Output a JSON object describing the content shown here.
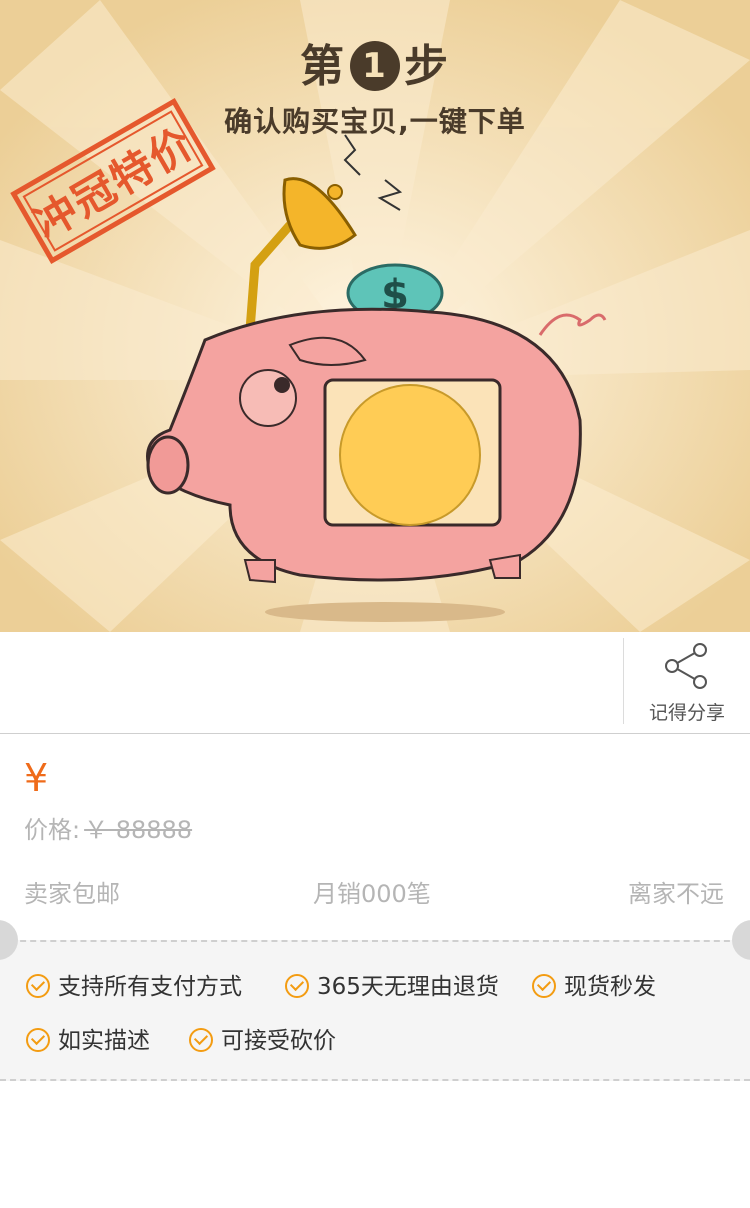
{
  "banner": {
    "step_prefix": "第",
    "step_number": "1",
    "step_suffix": "步",
    "subtitle": "确认购买宝贝,一键下单",
    "stamp_text": "冲冠特价",
    "coin_symbol": "$"
  },
  "share": {
    "label": "记得分享",
    "icon": "share-icon"
  },
  "price": {
    "currency_symbol": "¥",
    "label": "价格:",
    "original": "￥ 88888"
  },
  "meta": {
    "shipping": "卖家包邮",
    "monthly_sales": "月销000笔",
    "distance": "离家不远"
  },
  "features": [
    "支持所有支付方式",
    "365天无理由退货",
    "现货秒发",
    "如实描述",
    "可接受砍价"
  ],
  "colors": {
    "accent": "#ef6b1a",
    "check": "#f39c12",
    "banner_bg": "#f2d9a8",
    "stamp": "#e5582d"
  }
}
